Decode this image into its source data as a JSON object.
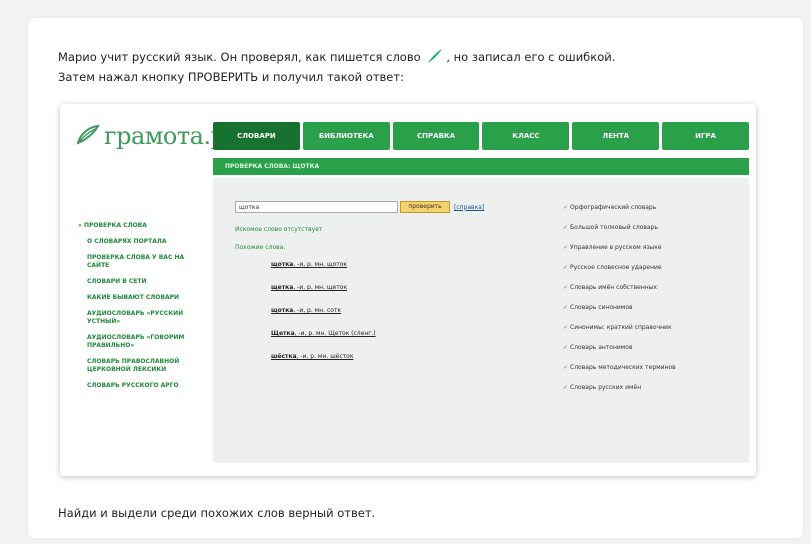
{
  "question": {
    "part1": "Марио учит русский язык. Он проверял, как пишется слово ",
    "part2": ", но записал его с ошибкой. Затем нажал кнопку ПРОВЕРИТЬ и получил такой ответ:"
  },
  "site": {
    "logo_text": "грамота.ру",
    "nav": [
      "СЛОВАРИ",
      "БИБЛИОТЕКА",
      "СПРАВКА",
      "КЛАСС",
      "ЛЕНТА",
      "ИГРА"
    ],
    "subheader": "ПРОВЕРКА СЛОВА: ЩОТКА",
    "sidebar": [
      "ПРОВЕРКА СЛОВА",
      "О СЛОВАРЯХ ПОРТАЛА",
      "ПРОВЕРКА СЛОВА У ВАС НА САЙТЕ",
      "СЛОВАРИ В СЕТИ",
      "КАКИЕ БЫВАЮТ СЛОВАРИ",
      "АУДИОСЛОВАРЬ «РУССКИЙ УСТНЫЙ»",
      "АУДИОСЛОВАРЬ «ГОВОРИМ ПРАВИЛЬНО»",
      "СЛОВАРЬ ПРАВОСЛАВНОЙ ЦЕРКОВНОЙ ЛЕКСИКИ",
      "СЛОВАРЬ РУССКОГО АРГО"
    ],
    "search_value": "щотка",
    "check_button": "проверить",
    "help_link": "[справка]",
    "not_found": "Искомое слово отсутствует",
    "similar_label": "Похожие слова:",
    "variants": [
      {
        "word": "щотка",
        "rest": ", -и, р. мн. щоток"
      },
      {
        "word": "щетка",
        "rest": ", -и, р. мн. щеток"
      },
      {
        "word": "щотка",
        "rest": ", -и, р. мн. сотк"
      },
      {
        "word": "Щетка",
        "rest": ", -и, р. мн. Щеток (сленг.)"
      },
      {
        "word": "шёстка",
        "rest": ", -и, р. мн. шёсток"
      }
    ],
    "dictionaries": [
      "Орфографический словарь",
      "Большой толковый словарь",
      "Управление в русском языке",
      "Русское словесное ударение",
      "Словарь имён собственных",
      "Словарь синонимов",
      "Синонимы: краткий справочник",
      "Словарь антонимов",
      "Словарь методических терминов",
      "Словарь русских имён"
    ]
  },
  "bottom_question": "Найди и выдели среди похожих слов верный ответ.",
  "colors": {
    "green": "#2aa04a",
    "dark_green": "#17722f",
    "button_yellow": "#f5d36a"
  }
}
